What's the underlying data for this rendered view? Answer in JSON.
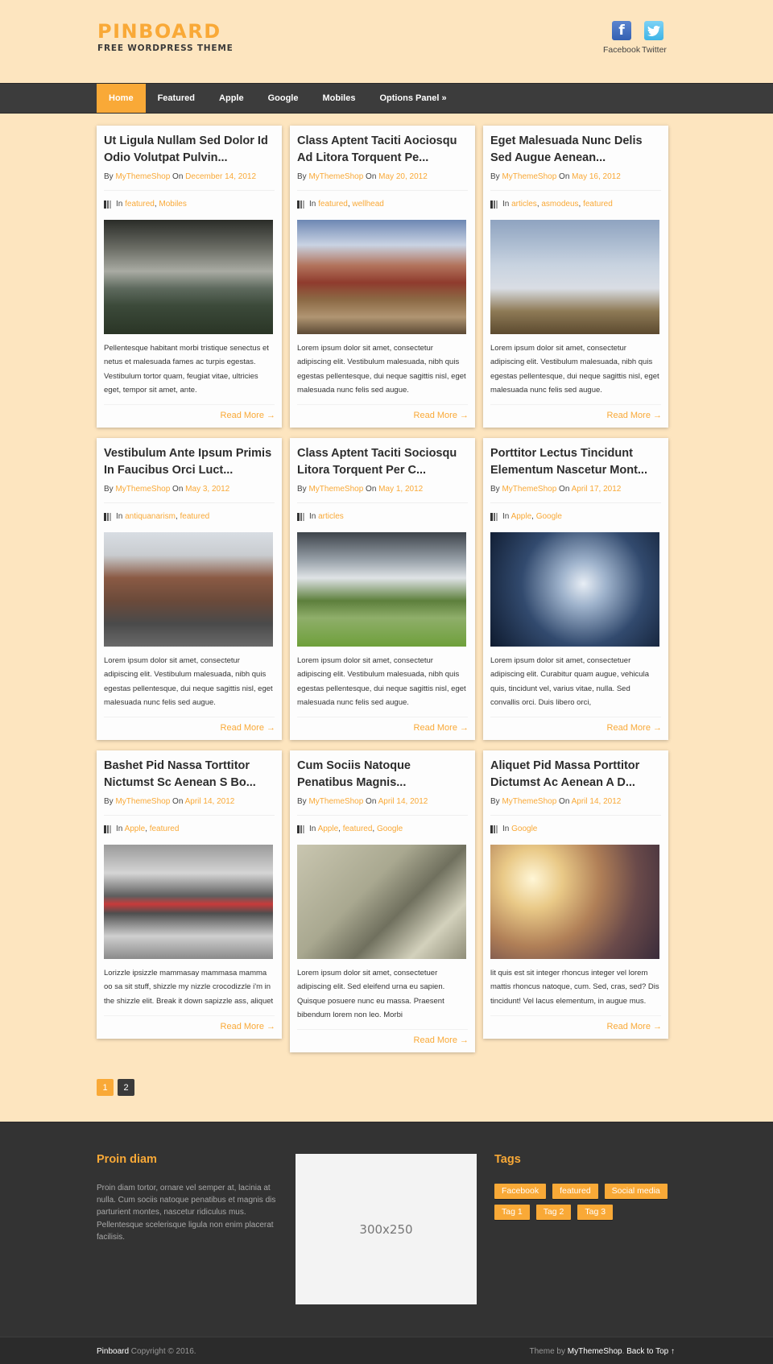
{
  "site": {
    "title": "PINBOARD",
    "subtitle": "FREE WORDPRESS THEME",
    "accent_color": "#f9a937",
    "dark_color": "#3c3c3c"
  },
  "social": [
    {
      "label": "Facebook",
      "icon": "facebook-icon",
      "glyph": "f"
    },
    {
      "label": "Twitter",
      "icon": "twitter-icon",
      "glyph": "🐦"
    }
  ],
  "nav": {
    "items": [
      {
        "label": "Home",
        "active": true
      },
      {
        "label": "Featured"
      },
      {
        "label": "Apple"
      },
      {
        "label": "Google"
      },
      {
        "label": "Mobiles"
      },
      {
        "label": "Options Panel »"
      }
    ]
  },
  "posts": [
    {
      "title": "Ut Ligula Nullam Sed Dolor Id Odio Volutpat Pulvin...",
      "by": "By",
      "author": "MyThemeShop",
      "on": "On",
      "date": "December 14, 2012",
      "in": "In",
      "cats": [
        "featured",
        "Mobiles"
      ],
      "image": "waterfall-storm",
      "excerpt": "Pellentesque habitant morbi tristique senectus et netus et malesuada fames ac turpis egestas. Vestibulum tortor quam, feugiat vitae, ultricies eget, tempor sit amet, ante.",
      "more": "Read More →"
    },
    {
      "title": "Class Aptent Taciti Aociosqu Ad Litora Torquent Pe...",
      "by": "By",
      "author": "MyThemeShop",
      "on": "On",
      "date": "May 20, 2012",
      "in": "In",
      "cats": [
        "featured",
        "wellhead"
      ],
      "image": "town-canal",
      "excerpt": "Lorem ipsum dolor sit amet, consectetur adipiscing elit. Vestibulum malesuada, nibh quis egestas pellentesque, dui neque sagittis nisl, eget malesuada nunc felis sed augue.",
      "more": "Read More →"
    },
    {
      "title": "Eget Malesuada Nunc Delis Sed Augue Aenean...",
      "by": "By",
      "author": "MyThemeShop",
      "on": "On",
      "date": "May 16, 2012",
      "in": "In",
      "cats": [
        "articles",
        "asmodeus",
        "featured"
      ],
      "image": "deer-hill",
      "excerpt": "Lorem ipsum dolor sit amet, consectetur adipiscing elit. Vestibulum malesuada, nibh quis egestas pellentesque, dui neque sagittis nisl, eget malesuada nunc felis sed augue.",
      "more": "Read More →"
    },
    {
      "title": "Vestibulum Ante Ipsum Primis In Faucibus Orci Luct...",
      "by": "By",
      "author": "MyThemeShop",
      "on": "On",
      "date": "May 3, 2012",
      "in": "In",
      "cats": [
        "antiquanarism",
        "featured"
      ],
      "image": "horse-carriage-street",
      "excerpt": "Lorem ipsum dolor sit amet, consectetur adipiscing elit. Vestibulum malesuada, nibh quis egestas pellentesque, dui neque sagittis nisl, eget malesuada nunc felis sed augue.",
      "more": "Read More →"
    },
    {
      "title": "Class Aptent Taciti Sociosqu Litora Torquent Per C...",
      "by": "By",
      "author": "MyThemeShop",
      "on": "On",
      "date": "May 1, 2012",
      "in": "In",
      "cats": [
        "articles"
      ],
      "image": "river-valley",
      "excerpt": "Lorem ipsum dolor sit amet, consectetur adipiscing elit. Vestibulum malesuada, nibh quis egestas pellentesque, dui neque sagittis nisl, eget malesuada nunc felis sed augue.",
      "more": "Read More →"
    },
    {
      "title": "Porttitor Lectus Tincidunt Elementum Nascetur Mont...",
      "by": "By",
      "author": "MyThemeShop",
      "on": "On",
      "date": "April 17, 2012",
      "in": "In",
      "cats": [
        "Apple",
        "Google"
      ],
      "image": "angel-space",
      "excerpt": "Lorem ipsum dolor sit amet, consectetuer adipiscing elit. Curabitur quam augue, vehicula quis, tincidunt vel, varius vitae, nulla. Sed convallis orci. Duis libero orci,",
      "more": "Read More →"
    },
    {
      "title": "Bashet Pid Nassa Torttitor Nictumst Sc Aenean S Bo...",
      "by": "By",
      "author": "MyThemeShop",
      "on": "On",
      "date": "April 14, 2012",
      "in": "In",
      "cats": [
        "Apple",
        "featured"
      ],
      "image": "fountain-red-bus",
      "excerpt": "Lorizzle ipsizzle mammasay mammasa mamma oo sa sit stuff, shizzle my nizzle crocodizzle i'm in the shizzle elit. Break it down sapizzle ass, aliquet",
      "more": "Read More →"
    },
    {
      "title": "Cum Sociis Natoque Penatibus Magnis...",
      "by": "By",
      "author": "MyThemeShop",
      "on": "On",
      "date": "April 14, 2012",
      "in": "In",
      "cats": [
        "Apple",
        "featured",
        "Google"
      ],
      "image": "skateboard-kid",
      "excerpt": "Lorem ipsum dolor sit amet, consectetuer adipiscing elit. Sed eleifend urna eu sapien. Quisque posuere nunc eu massa. Praesent bibendum lorem non leo. Morbi",
      "more": "Read More →"
    },
    {
      "title": "Aliquet Pid Massa Porttitor Dictumst Ac Aenean A D...",
      "by": "By",
      "author": "MyThemeShop",
      "on": "On",
      "date": "April 14, 2012",
      "in": "In",
      "cats": [
        "Google"
      ],
      "image": "couple-kiss-sunset",
      "excerpt": "lit quis est sit integer rhoncus integer vel lorem mattis rhoncus natoque, cum. Sed, cras, sed? Dis tincidunt! Vel lacus elementum, in augue mus.",
      "more": "Read More →"
    }
  ],
  "pagination": {
    "pages": [
      "1",
      "2"
    ],
    "current": "1"
  },
  "footer": {
    "about_title": "Proin diam",
    "about_text": "Proin diam tortor, ornare vel semper at, lacinia at nulla. Cum sociis natoque penatibus et magnis dis parturient montes, nascetur ridiculus mus. Pellentesque scelerisque ligula non enim placerat facilisis.",
    "ad_label": "300x250",
    "tags_title": "Tags",
    "tags": [
      "Facebook",
      "featured",
      "Social media",
      "Tag 1",
      "Tag 2",
      "Tag 3"
    ]
  },
  "bottom": {
    "brand": "Pinboard",
    "copyright": " Copyright © 2016.",
    "theme_by": "Theme by ",
    "theme_author": "MyThemeShop",
    "separator": ". ",
    "back_to_top": "Back to Top ↑"
  }
}
